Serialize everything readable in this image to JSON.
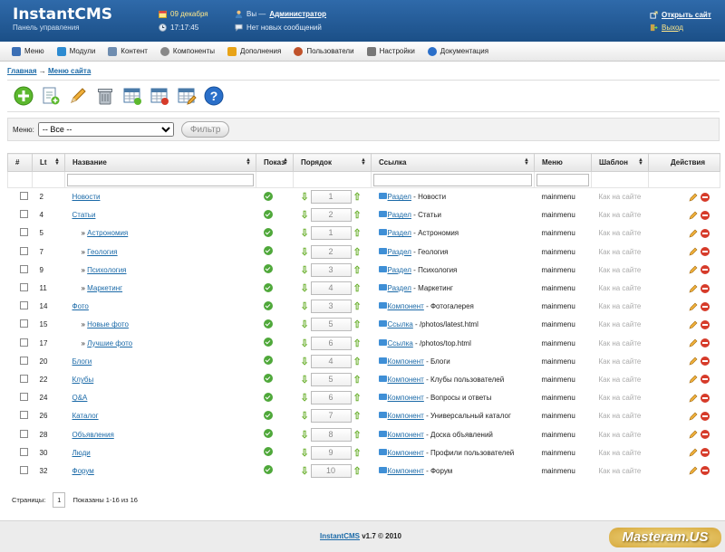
{
  "header": {
    "logo": "InstantCMS",
    "subtitle": "Панель управления",
    "date": "09 декабря",
    "time": "17:17:45",
    "user_prefix": "Вы —",
    "user_name": "Администратор",
    "messages": "Нет новых сообщений",
    "open_site": "Открыть сайт",
    "logout": "Выход"
  },
  "menu": [
    {
      "label": "Меню",
      "icon": "menu-icon",
      "color": "#3b6fb5"
    },
    {
      "label": "Модули",
      "icon": "modules-icon",
      "color": "#2d8bd1"
    },
    {
      "label": "Контент",
      "icon": "content-icon",
      "color": "#6f8db0"
    },
    {
      "label": "Компоненты",
      "icon": "gear-icon",
      "color": "#888888"
    },
    {
      "label": "Дополнения",
      "icon": "puzzle-icon",
      "color": "#e8a317"
    },
    {
      "label": "Пользователи",
      "icon": "users-icon",
      "color": "#c0522a"
    },
    {
      "label": "Настройки",
      "icon": "tools-icon",
      "color": "#777777"
    },
    {
      "label": "Документация",
      "icon": "help-icon",
      "color": "#2a6fc9"
    }
  ],
  "breadcrumb": {
    "home": "Главная",
    "sep": "→",
    "current": "Меню сайта"
  },
  "toolbar": [
    {
      "name": "add-icon"
    },
    {
      "name": "add-page-icon"
    },
    {
      "name": "edit-pencil-icon"
    },
    {
      "name": "trash-icon"
    },
    {
      "name": "table-green-icon"
    },
    {
      "name": "table-red-icon"
    },
    {
      "name": "table-edit-icon"
    },
    {
      "name": "help-icon"
    }
  ],
  "filter": {
    "label": "Меню:",
    "selected": "-- Все --",
    "button": "Фильтр"
  },
  "columns": [
    "#",
    "Lt",
    "Название",
    "Показ",
    "Порядок",
    "Ссылка",
    "Меню",
    "Шаблон",
    "Действия"
  ],
  "rows": [
    {
      "lt": "2",
      "indent": false,
      "title": "Новости",
      "order": "1",
      "link_type": "Раздел",
      "link_target": " - Новости",
      "menu": "mainmenu",
      "template": "Как на сайте"
    },
    {
      "lt": "4",
      "indent": false,
      "title": "Статьи",
      "order": "2",
      "link_type": "Раздел",
      "link_target": " - Статьи",
      "menu": "mainmenu",
      "template": "Как на сайте"
    },
    {
      "lt": "5",
      "indent": true,
      "title": "Астрономия",
      "order": "1",
      "link_type": "Раздел",
      "link_target": " - Астрономия",
      "menu": "mainmenu",
      "template": "Как на сайте"
    },
    {
      "lt": "7",
      "indent": true,
      "title": "Геология",
      "order": "2",
      "link_type": "Раздел",
      "link_target": " - Геология",
      "menu": "mainmenu",
      "template": "Как на сайте"
    },
    {
      "lt": "9",
      "indent": true,
      "title": "Психология",
      "order": "3",
      "link_type": "Раздел",
      "link_target": " - Психология",
      "menu": "mainmenu",
      "template": "Как на сайте"
    },
    {
      "lt": "11",
      "indent": true,
      "title": "Маркетинг",
      "order": "4",
      "link_type": "Раздел",
      "link_target": " - Маркетинг",
      "menu": "mainmenu",
      "template": "Как на сайте"
    },
    {
      "lt": "14",
      "indent": false,
      "title": "Фото",
      "order": "3",
      "link_type": "Компонент",
      "link_target": " - Фотогалерея",
      "menu": "mainmenu",
      "template": "Как на сайте"
    },
    {
      "lt": "15",
      "indent": true,
      "title": "Новые фото",
      "order": "5",
      "link_type": "Ссылка",
      "link_target": " - /photos/latest.html",
      "menu": "mainmenu",
      "template": "Как на сайте"
    },
    {
      "lt": "17",
      "indent": true,
      "title": "Лучшие фото",
      "order": "6",
      "link_type": "Ссылка",
      "link_target": " - /photos/top.html",
      "menu": "mainmenu",
      "template": "Как на сайте"
    },
    {
      "lt": "20",
      "indent": false,
      "title": "Блоги",
      "order": "4",
      "link_type": "Компонент",
      "link_target": " - Блоги",
      "menu": "mainmenu",
      "template": "Как на сайте"
    },
    {
      "lt": "22",
      "indent": false,
      "title": "Клубы",
      "order": "5",
      "link_type": "Компонент",
      "link_target": " - Клубы пользователей",
      "menu": "mainmenu",
      "template": "Как на сайте"
    },
    {
      "lt": "24",
      "indent": false,
      "title": "Q&A",
      "order": "6",
      "link_type": "Компонент",
      "link_target": " - Вопросы и ответы",
      "menu": "mainmenu",
      "template": "Как на сайте"
    },
    {
      "lt": "26",
      "indent": false,
      "title": "Каталог",
      "order": "7",
      "link_type": "Компонент",
      "link_target": " - Универсальный каталог",
      "menu": "mainmenu",
      "template": "Как на сайте"
    },
    {
      "lt": "28",
      "indent": false,
      "title": "Объявления",
      "order": "8",
      "link_type": "Компонент",
      "link_target": " - Доска объявлений",
      "menu": "mainmenu",
      "template": "Как на сайте"
    },
    {
      "lt": "30",
      "indent": false,
      "title": "Люди",
      "order": "9",
      "link_type": "Компонент",
      "link_target": " - Профили пользователей",
      "menu": "mainmenu",
      "template": "Как на сайте"
    },
    {
      "lt": "32",
      "indent": false,
      "title": "Форум",
      "order": "10",
      "link_type": "Компонент",
      "link_target": " - Форум",
      "menu": "mainmenu",
      "template": "Как на сайте"
    }
  ],
  "pager": {
    "label": "Страницы:",
    "page": "1",
    "summary": "Показаны 1-16 из 16"
  },
  "footer": {
    "product": "InstantCMS",
    "version": " v1.7 © 2010"
  },
  "watermark": "Masteram.US"
}
